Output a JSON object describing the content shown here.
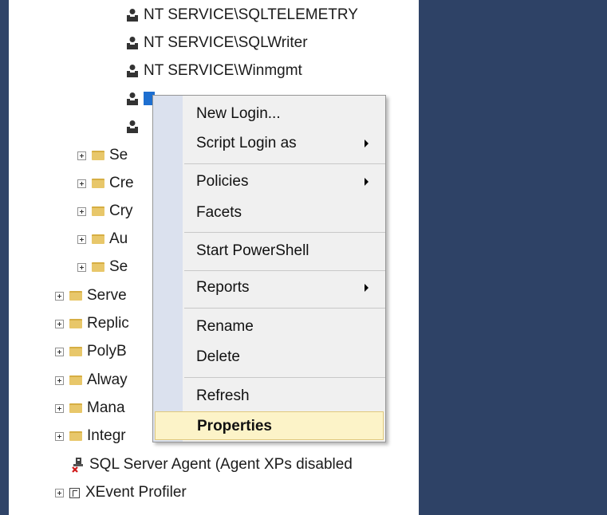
{
  "tree": {
    "users": [
      "NT SERVICE\\SQLTELEMETRY",
      "NT SERVICE\\SQLWriter",
      "NT SERVICE\\Winmgmt"
    ],
    "security_children_partial": [
      "Se",
      "Cre",
      "Cry",
      "Au",
      "Se"
    ],
    "server_children_partial": [
      "Serve",
      "Replic",
      "PolyB",
      "Alway",
      "Mana",
      "Integr"
    ],
    "agent_label": "SQL Server Agent (Agent XPs disabled",
    "xevent_label": "XEvent Profiler"
  },
  "context_menu": {
    "new_login": "New Login...",
    "script_login_as": "Script Login as",
    "policies": "Policies",
    "facets": "Facets",
    "start_powershell": "Start PowerShell",
    "reports": "Reports",
    "rename": "Rename",
    "delete": "Delete",
    "refresh": "Refresh",
    "properties": "Properties"
  },
  "colors": {
    "side_panel": "#2e4266",
    "menu_gutter": "#dbe1ee",
    "highlight": "#fcf3c8",
    "folder": "#e8c76a",
    "selection": "#1e6fd0"
  }
}
